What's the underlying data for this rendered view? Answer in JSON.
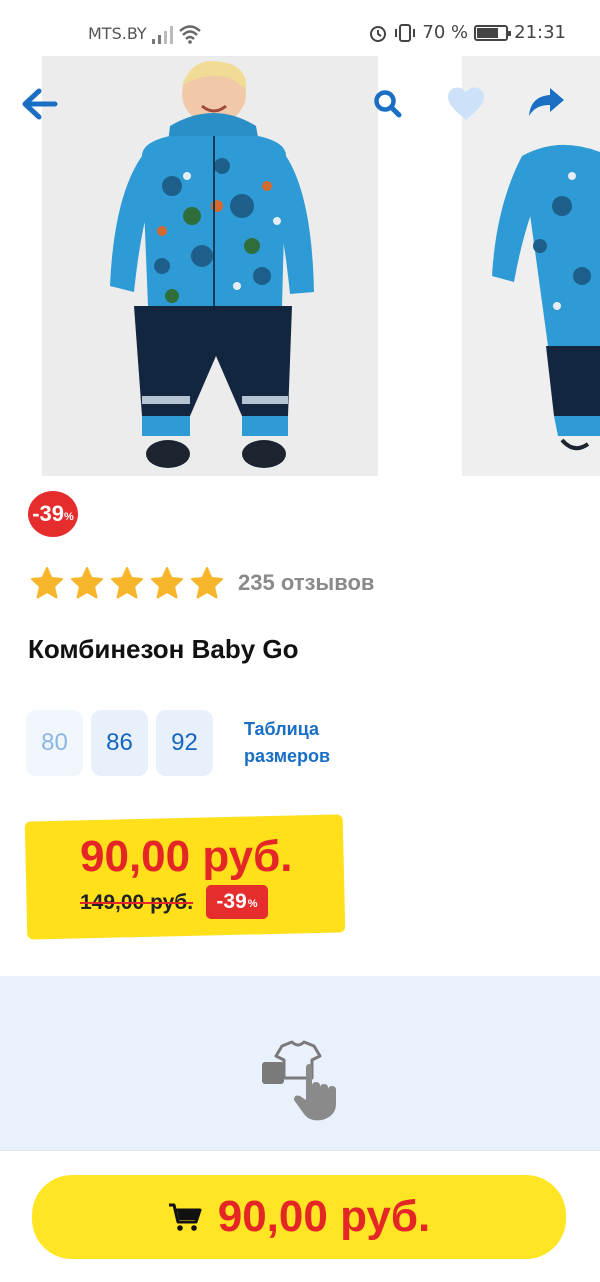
{
  "status_bar": {
    "carrier": "MTS.BY",
    "battery": "70 %",
    "time": "21:31"
  },
  "icons": {
    "back": "arrow-left-icon",
    "search": "search-icon",
    "favorite": "heart-icon",
    "share": "share-icon",
    "cart": "cart-icon",
    "try_on": "try-on-icon"
  },
  "colors": {
    "accent_blue": "#1a6fc4",
    "sale_red": "#e52d2d",
    "price_yellow": "#ffe01b",
    "star_yellow": "#f7b52c"
  },
  "product": {
    "discount": {
      "value": "-39",
      "unit": "%"
    },
    "rating": {
      "stars": 5,
      "max": 5,
      "reviews": "235 отзывов"
    },
    "title": "Комбинезон Baby Go",
    "sizes": [
      {
        "label": "80",
        "available": false
      },
      {
        "label": "86",
        "available": true
      },
      {
        "label": "92",
        "available": true
      }
    ],
    "size_table_label": "Таблица размеров",
    "price": {
      "current": "90,00 руб.",
      "old": "149,00 руб.",
      "discount": "-39",
      "discount_unit": "%"
    }
  },
  "bottom_bar": {
    "buy_price": "90,00 руб."
  }
}
